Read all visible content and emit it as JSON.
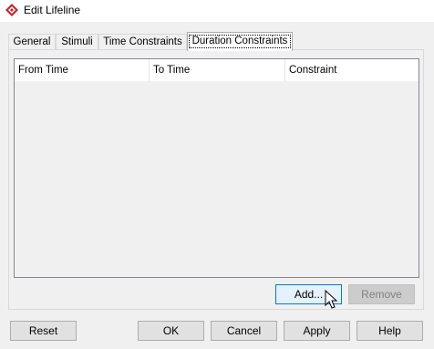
{
  "window": {
    "title": "Edit Lifeline",
    "icon": "visual-paradigm-logo-icon"
  },
  "tabs": [
    {
      "label": "General",
      "active": false
    },
    {
      "label": "Stimuli",
      "active": false
    },
    {
      "label": "Time Constraints",
      "active": false
    },
    {
      "label": "Duration Constraints",
      "active": true
    }
  ],
  "table": {
    "columns": [
      "From Time",
      "To Time",
      "Constraint"
    ],
    "rows": []
  },
  "panel_buttons": {
    "add": "Add...",
    "remove": "Remove"
  },
  "footer_buttons": {
    "reset": "Reset",
    "ok": "OK",
    "cancel": "Cancel",
    "apply": "Apply",
    "help": "Help"
  },
  "colors": {
    "icon_red": "#c4262e",
    "focus_border": "#0078d7"
  }
}
